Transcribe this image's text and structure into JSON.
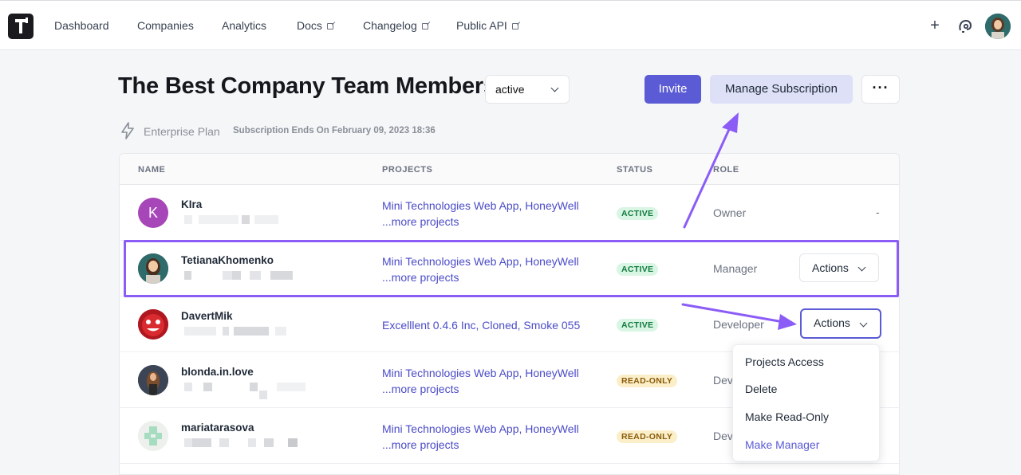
{
  "nav": {
    "items": [
      {
        "label": "Dashboard",
        "external": false
      },
      {
        "label": "Companies",
        "external": false
      },
      {
        "label": "Analytics",
        "external": false
      },
      {
        "label": "Docs",
        "external": true
      },
      {
        "label": "Changelog",
        "external": true
      },
      {
        "label": "Public API",
        "external": true
      }
    ],
    "plus_label": "+"
  },
  "header": {
    "title": "The Best Company Team Members",
    "status_filter": "active",
    "invite_label": "Invite",
    "manage_label": "Manage Subscription",
    "more_label": "···",
    "plan_label": "Enterprise Plan",
    "subscription_ends": "Subscription Ends On February 09, 2023 18:36"
  },
  "table": {
    "columns": [
      "NAME",
      "PROJECTS",
      "STATUS",
      "ROLE"
    ],
    "rows": [
      {
        "name": "KIra",
        "avatar_letter": "K",
        "projects": "Mini Technologies Web App, HoneyWell",
        "more": "...more projects",
        "status": "ACTIVE",
        "role": "Owner",
        "action": "-"
      },
      {
        "name": "TetianaKhomenko",
        "projects": "Mini Technologies Web App, HoneyWell",
        "more": "...more projects",
        "status": "ACTIVE",
        "role": "Manager",
        "action": "Actions"
      },
      {
        "name": "DavertMik",
        "projects": "Excelllent 0.4.6 Inc, Cloned, Smoke 055",
        "more": "",
        "status": "ACTIVE",
        "role": "Developer",
        "action": "Actions"
      },
      {
        "name": "blonda.in.love",
        "projects": "Mini Technologies Web App, HoneyWell",
        "more": "...more projects",
        "status": "READ-ONLY",
        "role": "Deve",
        "action": ""
      },
      {
        "name": "mariatarasova",
        "projects": "Mini Technologies Web App, HoneyWell",
        "more": "...more projects",
        "status": "READ-ONLY",
        "role": "Deve",
        "action": ""
      }
    ]
  },
  "actions_menu": {
    "items": [
      "Projects Access",
      "Delete",
      "Make Read-Only",
      "Make Manager"
    ],
    "highlighted": "Make Manager"
  },
  "colors": {
    "accent": "#5b5bd6",
    "annotation": "#8b5cf6",
    "active_badge_bg": "#d9f5e4",
    "readonly_badge_bg": "#fbefc9"
  }
}
